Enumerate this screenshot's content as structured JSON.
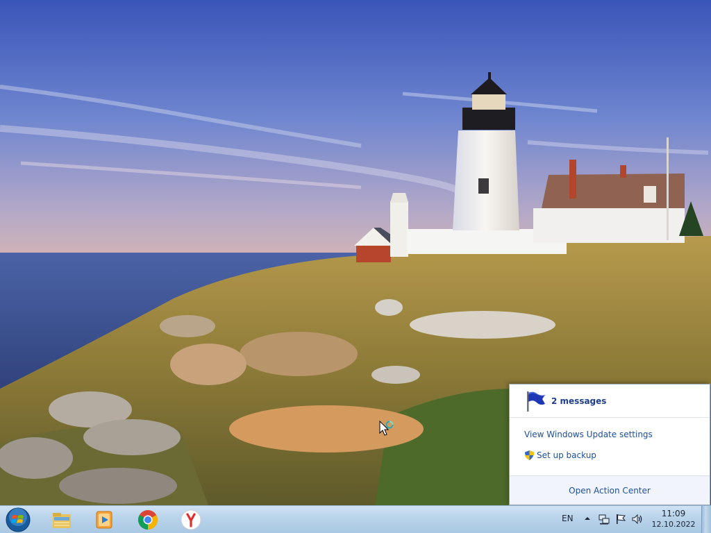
{
  "desktop": {
    "wallpaper_icon": "lighthouse-landscape-wallpaper"
  },
  "action_center": {
    "flag_icon": "action-center-flag-icon",
    "messages_label": "2 messages",
    "windows_update_link": "View Windows Update settings",
    "backup_link": "Set up backup",
    "backup_icon": "uac-shield-icon",
    "open_label": "Open Action Center"
  },
  "taskbar": {
    "start_icon": "windows-start-orb-icon",
    "pinned": [
      {
        "name": "windows-explorer-icon"
      },
      {
        "name": "windows-media-player-icon"
      },
      {
        "name": "google-chrome-icon"
      },
      {
        "name": "yandex-browser-icon"
      }
    ],
    "tray": {
      "language": "EN",
      "chevron_icon": "show-hidden-icons-chevron",
      "network_icon": "network-icon",
      "action_center_icon": "action-center-flag-icon",
      "volume_icon": "volume-icon"
    },
    "clock": {
      "time": "11:09",
      "date": "12.10.2022"
    }
  },
  "colors": {
    "taskbar": "#b8d3ea",
    "link": "#1d4f99",
    "popup_header_text": "#1e3f8c"
  }
}
